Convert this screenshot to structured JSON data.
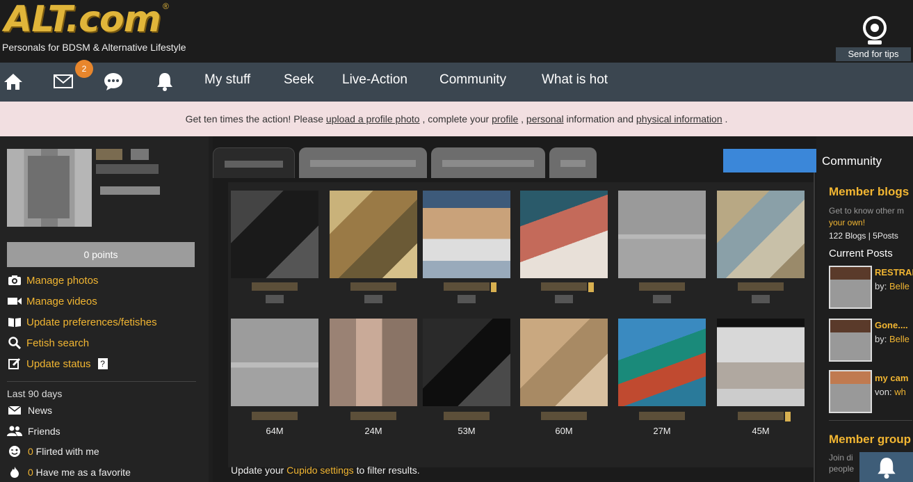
{
  "header": {
    "logo_text": "ALT.com",
    "logo_reg": "®",
    "tagline": "Personals for BDSM & Alternative Lifestyle",
    "send_tips_label": "Send for tips",
    "send_tips_icon": "webcam-icon"
  },
  "nav": {
    "icons": [
      "home-icon",
      "mail-icon",
      "chat-icon",
      "bell-icon"
    ],
    "mail_badge": "2",
    "links": [
      "My stuff",
      "Seek",
      "Live-Action",
      "Community",
      "What is hot"
    ]
  },
  "notice": {
    "prefix": "Get ten times the action! Please ",
    "link1": "upload a profile photo",
    "mid1": " , complete your ",
    "link2": "profile",
    "mid2": " , ",
    "link3": "personal",
    "mid3": " information and ",
    "link4": "physical information",
    "suffix": " ."
  },
  "left": {
    "points_label": "0 points",
    "menu": [
      {
        "label": "Manage photos",
        "icon": "camera-icon"
      },
      {
        "label": "Manage videos",
        "icon": "video-icon"
      },
      {
        "label": "Update preferences/fetishes",
        "icon": "book-icon"
      },
      {
        "label": "Fetish search",
        "icon": "search-icon"
      },
      {
        "label": "Update status",
        "icon": "edit-icon",
        "help": "?"
      }
    ],
    "last90_label": "Last 90 days",
    "stats": [
      {
        "num": "",
        "label": "News",
        "icon": "envelope-icon"
      },
      {
        "num": "",
        "label": "Friends",
        "icon": "friends-icon"
      },
      {
        "num": "0",
        "label": " Flirted with me",
        "icon": "wink-icon"
      },
      {
        "num": "0",
        "label": " Have me as a favorite",
        "icon": "fire-icon"
      }
    ]
  },
  "center": {
    "row2_ages": [
      "64M",
      "24M",
      "53M",
      "60M",
      "27M",
      "45M"
    ],
    "filter_prefix": "Update your ",
    "filter_link": "Cupido settings",
    "filter_suffix": " to filter results."
  },
  "right": {
    "title": "Community",
    "member_blogs": "Member blogs",
    "blogs_desc": "Get to know other m",
    "blogs_link": "your own!",
    "blogs_count": "122 Blogs | 5Posts",
    "current_posts": "Current Posts",
    "posts": [
      {
        "title": "RESTRAI",
        "by_prefix": "by: ",
        "user": "Belle"
      },
      {
        "title": "Gone....",
        "by_prefix": "by: ",
        "user": "Belle"
      },
      {
        "title": "my cam",
        "by_prefix": "von: ",
        "user": "wh"
      }
    ],
    "member_groups": "Member group",
    "groups_desc1": "Join di",
    "groups_desc2": "people"
  },
  "colors": {
    "accent": "#f2b632",
    "nav_bg": "#3b4650",
    "notice_bg": "#f2dfe1",
    "badge": "#e8862c",
    "blue_button": "#3b87d9"
  }
}
